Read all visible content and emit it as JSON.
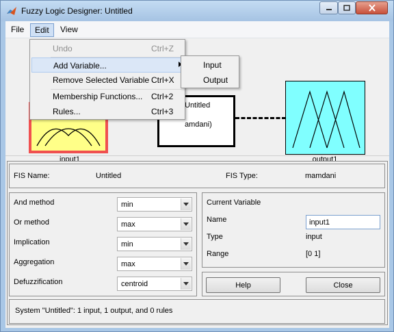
{
  "window": {
    "title": "Fuzzy Logic Designer: Untitled"
  },
  "menubar": {
    "file": "File",
    "edit": "Edit",
    "view": "View"
  },
  "edit_menu": {
    "items": [
      {
        "label": "Undo",
        "shortcut": "Ctrl+Z",
        "enabled": false
      },
      {
        "label": "Add Variable...",
        "shortcut": "",
        "submenu": true
      },
      {
        "label": "Remove Selected Variable",
        "shortcut": "Ctrl+X"
      },
      {
        "label": "Membership Functions...",
        "shortcut": "Ctrl+2"
      },
      {
        "label": "Rules...",
        "shortcut": "Ctrl+3"
      }
    ],
    "submenu_items": [
      {
        "label": "Input"
      },
      {
        "label": "Output"
      }
    ]
  },
  "diagram": {
    "input_label": "input1",
    "output_label": "output1",
    "fis_line1": "Untitled",
    "fis_line2": "amdani)",
    "input_color": "#ffff88",
    "output_color": "#80ffff",
    "selected_border_color": "#f05050"
  },
  "fis_info": {
    "name_label": "FIS Name:",
    "name_value": "Untitled",
    "type_label": "FIS Type:",
    "type_value": "mamdani"
  },
  "methods": [
    {
      "label": "And method",
      "value": "min"
    },
    {
      "label": "Or method",
      "value": "max"
    },
    {
      "label": "Implication",
      "value": "min"
    },
    {
      "label": "Aggregation",
      "value": "max"
    },
    {
      "label": "Defuzzification",
      "value": "centroid"
    }
  ],
  "current_variable": {
    "heading": "Current Variable",
    "name_label": "Name",
    "name_value": "input1",
    "type_label": "Type",
    "type_value": "input",
    "range_label": "Range",
    "range_value": "[0 1]"
  },
  "buttons": {
    "help": "Help",
    "close": "Close"
  },
  "status": "System \"Untitled\": 1 input, 1 output, and 0 rules",
  "icons": [
    "matlab-icon",
    "minimize-icon",
    "maximize-icon",
    "close-icon",
    "chevron-down-icon",
    "submenu-arrow-icon"
  ]
}
